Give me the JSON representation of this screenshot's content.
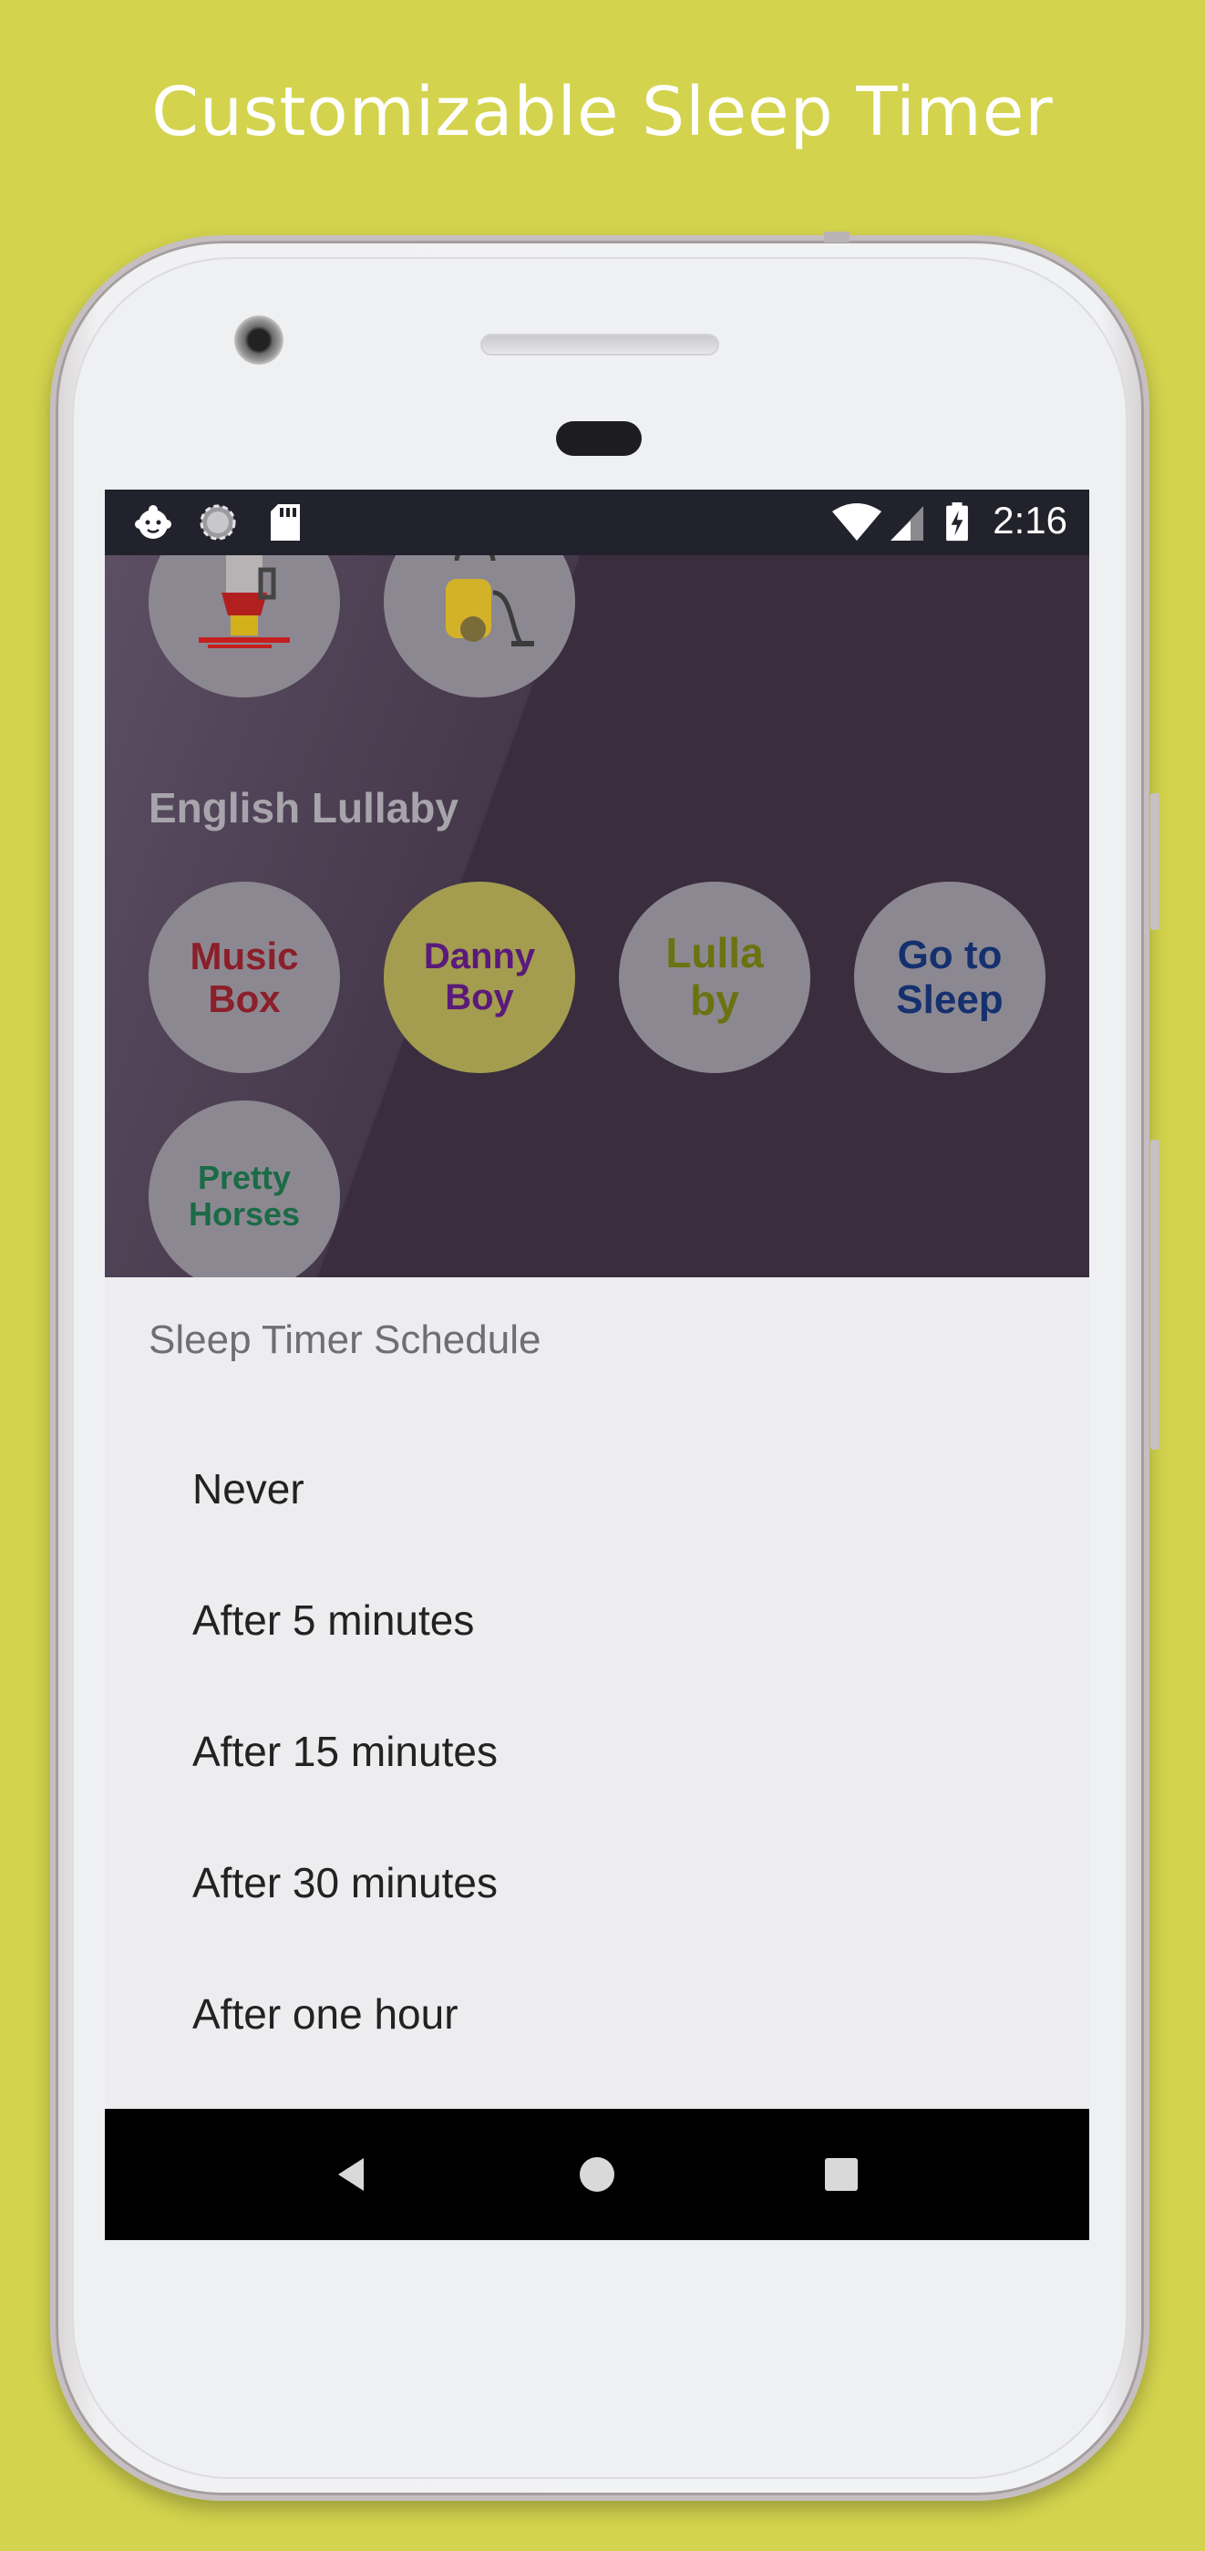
{
  "headline": "Customizable Sleep Timer",
  "status_bar": {
    "time": "2:16",
    "left_icons": [
      "baby-face-icon",
      "loading-circle-icon",
      "sd-card-icon"
    ],
    "right_icons": [
      "wifi-icon",
      "signal-icon",
      "battery-charging-icon"
    ]
  },
  "background_app": {
    "section_label": "English Lullaby",
    "top_row_icons": [
      "blender-icon",
      "vacuum-cleaner-icon"
    ],
    "lullaby_buttons": [
      {
        "line1": "Music",
        "line2": "Box",
        "color": "#8b1f2a"
      },
      {
        "line1": "Danny",
        "line2": "Boy",
        "color": "#5a1a7a"
      },
      {
        "line1": "Lulla",
        "line2": "by",
        "color": "#6b7210"
      },
      {
        "line1": "Go to",
        "line2": "Sleep",
        "color": "#15306e"
      },
      {
        "line1": "Pretty",
        "line2": "Horses",
        "color": "#1a6b46"
      }
    ]
  },
  "dialog": {
    "title": "Sleep Timer Schedule",
    "options": [
      "Never",
      "After 5 minutes",
      "After 15 minutes",
      "After 30 minutes",
      "After one hour"
    ]
  },
  "nav_bar": {
    "back_icon": "back-triangle-icon",
    "home_icon": "home-circle-icon",
    "recents_icon": "recents-square-icon"
  },
  "colors": {
    "page_background": "#d3d34e",
    "status_bar": "#22222c",
    "dim_overlay": "#3a2d3e",
    "sheet_background": "#ededef",
    "selected_circle": "#a49c4f"
  }
}
